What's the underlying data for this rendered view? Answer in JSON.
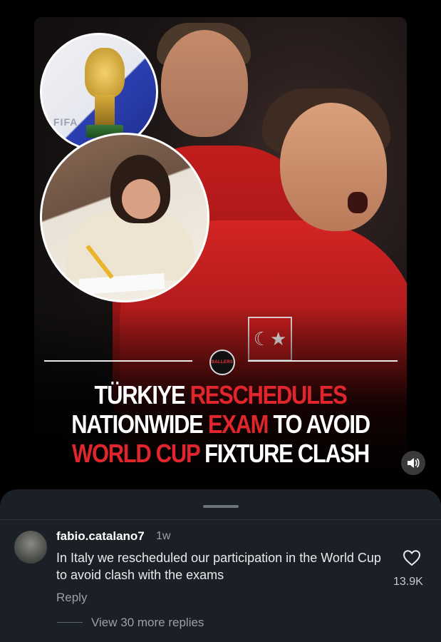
{
  "post": {
    "headline": {
      "line1": {
        "white": "TÜRKIYE",
        "red": "RESCHEDULES"
      },
      "line2": {
        "white_a": "NATIONWIDE",
        "red": "EXAM",
        "white_b": "TO AVOID"
      },
      "line3": {
        "red": "WORLD CUP",
        "white": "FIXTURE CLASH"
      }
    },
    "inset_trophy_text": "FIFA",
    "badge_text": "BALLERS",
    "flag_glyph": "☾★",
    "sound_icon": "speaker-icon"
  },
  "colors": {
    "headline_red": "#e0262c",
    "sheet_background": "#1a2026",
    "muted_text": "#9aa0a6"
  },
  "comment": {
    "username": "fabio.catalano7",
    "time": "1w",
    "text": "In Italy we rescheduled our participation in the World Cup to avoid clash with the exams",
    "reply_label": "Reply",
    "like_count": "13.9K",
    "like_icon": "heart-icon"
  },
  "replies": {
    "view_more_label": "View 30 more replies"
  }
}
